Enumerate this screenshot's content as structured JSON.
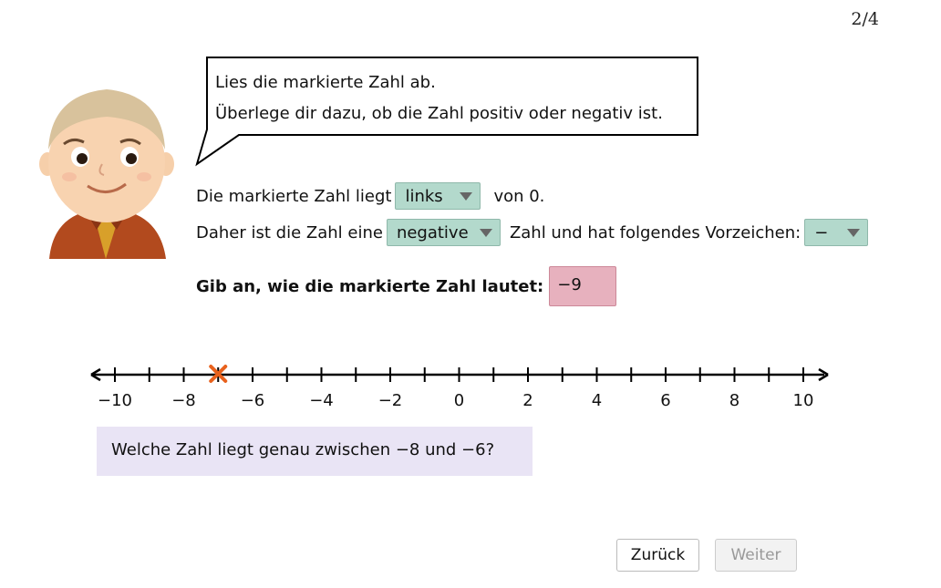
{
  "page_counter": "2/4",
  "speech": {
    "line1": "Lies die markierte Zahl ab.",
    "line2": "Überlege dir dazu, ob die Zahl positiv oder negativ ist."
  },
  "row1": {
    "prefix": "Die markierte Zahl liegt",
    "dropdown_value": "links",
    "suffix": "von 0."
  },
  "row2": {
    "prefix": "Daher ist die Zahl eine",
    "dropdown_value": "negative",
    "middle": "Zahl und hat folgendes Vorzeichen:",
    "sign_value": "−"
  },
  "question": {
    "label": "Gib an, wie die markierte Zahl lautet:",
    "answer": "−9"
  },
  "number_line": {
    "min": -10,
    "max": 10,
    "tick_step": 1,
    "label_step": 2,
    "labels": [
      "−10",
      "−8",
      "−6",
      "−4",
      "−2",
      "0",
      "2",
      "4",
      "6",
      "8",
      "10"
    ],
    "marker_value": -7,
    "marker_color": "#e8611c"
  },
  "hint": "Welche Zahl liegt genau zwischen −8 und −6?",
  "buttons": {
    "back": "Zurück",
    "next": "Weiter"
  },
  "colors": {
    "dropdown_bg": "#b3d9cc",
    "answer_bg": "#e7b1be",
    "hint_bg": "#e9e4f5"
  }
}
